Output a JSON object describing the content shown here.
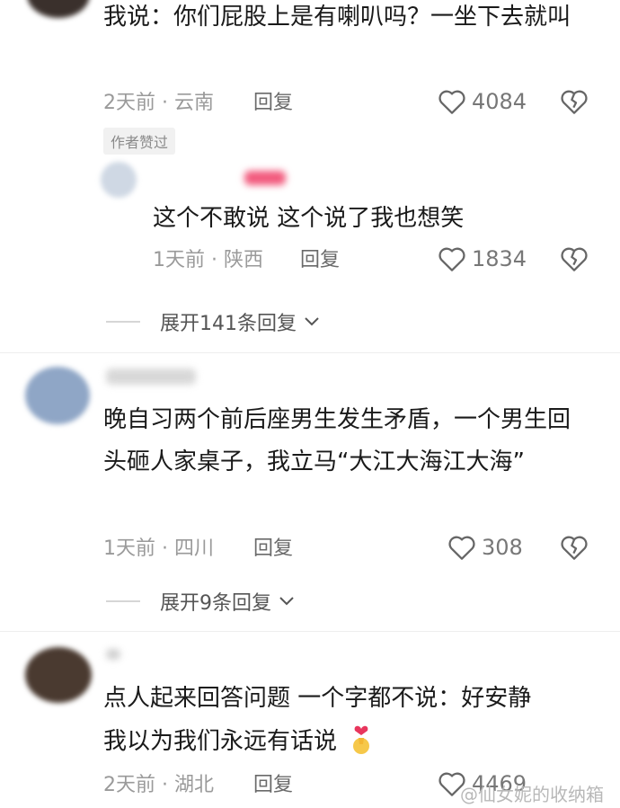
{
  "comments": [
    {
      "text": "我说：你们屁股上是有喇叭吗？一坐下去就叫",
      "date": "2天前",
      "location": "云南",
      "reply_label": "回复",
      "likes": "4084",
      "badge": "作者赞过",
      "replies": [
        {
          "text": "这个不敢说 这个说了我也想笑",
          "date": "1天前",
          "location": "陕西",
          "reply_label": "回复",
          "likes": "1834"
        }
      ],
      "expand_label": "展开141条回复"
    },
    {
      "text": "晚自习两个前后座男生发生矛盾，一个男生回头砸人家桌子，我立马“大江大海江大海”",
      "date": "1天前",
      "location": "四川",
      "reply_label": "回复",
      "likes": "308",
      "expand_label": "展开9条回复"
    },
    {
      "text_line1": "点人起来回答问题 一个字都不说：好安静",
      "text_line2": "我以为我们永远有话说",
      "date": "2天前",
      "location": "湖北",
      "reply_label": "回复",
      "likes": "4469"
    }
  ],
  "meta_separator": "·",
  "watermark": "@仙女妮的收纳箱",
  "icons": {
    "like": "heart-outline-icon",
    "dislike": "broken-heart-icon",
    "expand": "chevron-down-icon",
    "emoji": "finger-heart-emoji"
  },
  "colors": {
    "text": "#1a1a1a",
    "meta": "#9a9a9a",
    "icon": "#666666",
    "emoji_heart": "#e8365d",
    "emoji_hand": "#f6c84a"
  }
}
